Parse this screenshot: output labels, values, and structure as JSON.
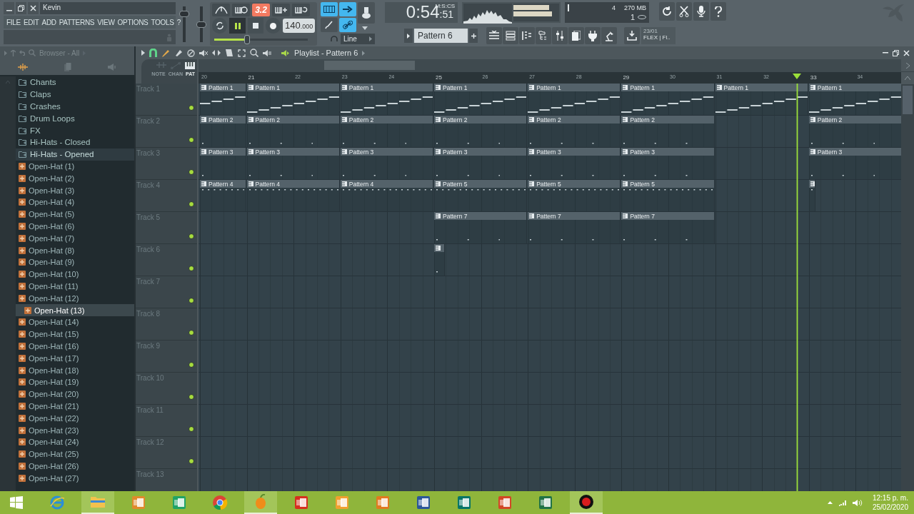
{
  "window": {
    "title": "Kevin"
  },
  "menu": [
    "FILE",
    "EDIT",
    "ADD",
    "PATTERNS",
    "VIEW",
    "OPTIONS",
    "TOOLS",
    "?"
  ],
  "mixer_faders": [
    {
      "level": 0.85
    },
    {
      "level": 0.5
    }
  ],
  "transport": {
    "counter_button": "3.2",
    "playing": true,
    "tempo_main": "140",
    "tempo_fraction": ".000"
  },
  "song_position": {
    "level": 0.35
  },
  "snap": "Line",
  "time": {
    "main": "0:54",
    "small": ":51",
    "unit": "M:S:CS"
  },
  "pattern_selector": "Pattern 6",
  "cpu": {
    "voices": "4",
    "memory": "270 MB",
    "polyphony": "1"
  },
  "news": {
    "date": "23/01",
    "title": "FLEX | Fl.."
  },
  "browser": {
    "title": "Browser - All",
    "items": [
      {
        "label": "Chants",
        "kind": "folder",
        "selected": false
      },
      {
        "label": "Claps",
        "kind": "folder",
        "selected": false
      },
      {
        "label": "Crashes",
        "kind": "folder",
        "selected": false
      },
      {
        "label": "Drum Loops",
        "kind": "folder",
        "selected": false
      },
      {
        "label": "FX",
        "kind": "folder",
        "selected": false
      },
      {
        "label": "Hi-Hats - Closed",
        "kind": "folder",
        "selected": false
      },
      {
        "label": "Hi-Hats - Opened",
        "kind": "folder",
        "selected": true
      },
      {
        "label": "Open-Hat (1)",
        "kind": "file",
        "selected": false
      },
      {
        "label": "Open-Hat (2)",
        "kind": "file",
        "selected": false
      },
      {
        "label": "Open-Hat (3)",
        "kind": "file",
        "selected": false
      },
      {
        "label": "Open-Hat (4)",
        "kind": "file",
        "selected": false
      },
      {
        "label": "Open-Hat (5)",
        "kind": "file",
        "selected": false
      },
      {
        "label": "Open-Hat (6)",
        "kind": "file",
        "selected": false
      },
      {
        "label": "Open-Hat (7)",
        "kind": "file",
        "selected": false
      },
      {
        "label": "Open-Hat (8)",
        "kind": "file",
        "selected": false
      },
      {
        "label": "Open-Hat (9)",
        "kind": "file",
        "selected": false
      },
      {
        "label": "Open-Hat (10)",
        "kind": "file",
        "selected": false
      },
      {
        "label": "Open-Hat (11)",
        "kind": "file",
        "selected": false
      },
      {
        "label": "Open-Hat (12)",
        "kind": "file",
        "selected": false
      },
      {
        "label": "Open-Hat (13)",
        "kind": "file",
        "selected": true
      },
      {
        "label": "Open-Hat (14)",
        "kind": "file",
        "selected": false
      },
      {
        "label": "Open-Hat (15)",
        "kind": "file",
        "selected": false
      },
      {
        "label": "Open-Hat (16)",
        "kind": "file",
        "selected": false
      },
      {
        "label": "Open-Hat (17)",
        "kind": "file",
        "selected": false
      },
      {
        "label": "Open-Hat (18)",
        "kind": "file",
        "selected": false
      },
      {
        "label": "Open-Hat (19)",
        "kind": "file",
        "selected": false
      },
      {
        "label": "Open-Hat (20)",
        "kind": "file",
        "selected": false
      },
      {
        "label": "Open-Hat (21)",
        "kind": "file",
        "selected": false
      },
      {
        "label": "Open-Hat (22)",
        "kind": "file",
        "selected": false
      },
      {
        "label": "Open-Hat (23)",
        "kind": "file",
        "selected": false
      },
      {
        "label": "Open-Hat (24)",
        "kind": "file",
        "selected": false
      },
      {
        "label": "Open-Hat (25)",
        "kind": "file",
        "selected": false
      },
      {
        "label": "Open-Hat (26)",
        "kind": "file",
        "selected": false
      },
      {
        "label": "Open-Hat (27)",
        "kind": "file",
        "selected": false
      }
    ]
  },
  "playlist": {
    "title": "Playlist - Pattern 6",
    "header_tabs": [
      {
        "label": "NOTE",
        "selected": false
      },
      {
        "label": "CHAN",
        "selected": false
      },
      {
        "label": "PAT",
        "selected": true
      }
    ],
    "ruler": [
      "20",
      "21",
      "22",
      "23",
      "24",
      "25",
      "26",
      "27",
      "28",
      "29",
      "30",
      "31",
      "32",
      "33",
      "34"
    ],
    "tracks": [
      {
        "name": "Track 1",
        "enabled": true,
        "clips": [
          {
            "label": "Pattern 1",
            "kind": "melody"
          },
          {
            "label": "Pattern 1",
            "kind": "melody"
          },
          {
            "label": "Pattern 1",
            "kind": "melody"
          },
          {
            "label": "Pattern 1",
            "kind": "melody"
          },
          {
            "label": "Pattern 1",
            "kind": "melody"
          },
          {
            "label": "Pattern 1",
            "kind": "melody"
          },
          {
            "label": "Pattern 1",
            "kind": "melody"
          },
          {
            "label": "Pattern 1",
            "kind": "melody"
          }
        ]
      },
      {
        "name": "Track 2",
        "enabled": true,
        "clips": [
          {
            "label": "Pattern 2",
            "kind": "drums"
          },
          {
            "label": "Pattern 2",
            "kind": "drums"
          },
          {
            "label": "Pattern 2",
            "kind": "drums"
          },
          {
            "label": "Pattern 2",
            "kind": "drums"
          },
          {
            "label": "Pattern 2",
            "kind": "drums"
          },
          {
            "label": "Pattern 2",
            "kind": "drums"
          },
          {
            "label": "Pattern 2",
            "kind": "drums"
          }
        ]
      },
      {
        "name": "Track 3",
        "enabled": true,
        "clips": [
          {
            "label": "Pattern 3",
            "kind": "drums"
          },
          {
            "label": "Pattern 3",
            "kind": "drums"
          },
          {
            "label": "Pattern 3",
            "kind": "drums"
          },
          {
            "label": "Pattern 3",
            "kind": "drums"
          },
          {
            "label": "Pattern 3",
            "kind": "drums"
          },
          {
            "label": "Pattern 3",
            "kind": "drums"
          },
          {
            "label": "Pattern 3",
            "kind": "drums"
          }
        ]
      },
      {
        "name": "Track 4",
        "enabled": true,
        "clips": [
          {
            "label": "Pattern 4",
            "kind": "hats"
          },
          {
            "label": "Pattern 4",
            "kind": "hats"
          },
          {
            "label": "Pattern 4",
            "kind": "hats"
          },
          {
            "label": "Pattern 5",
            "kind": "hats"
          },
          {
            "label": "Pattern 5",
            "kind": "hats"
          },
          {
            "label": "Pattern 5",
            "kind": "hats"
          },
          {
            "kind": "hats"
          }
        ]
      },
      {
        "name": "Track 5",
        "enabled": true,
        "clips": [
          {
            "label": "Pattern 7",
            "kind": "drums"
          },
          {
            "label": "Pattern 7",
            "kind": "drums"
          },
          {
            "label": "Pattern 7",
            "kind": "drums"
          }
        ]
      },
      {
        "name": "Track 6",
        "enabled": true,
        "clips": [
          {
            "kind": "drums"
          }
        ]
      },
      {
        "name": "Track 7",
        "enabled": true
      },
      {
        "name": "Track 8",
        "enabled": true
      },
      {
        "name": "Track 9",
        "enabled": true
      },
      {
        "name": "Track 10",
        "enabled": true
      },
      {
        "name": "Track 11",
        "enabled": true
      },
      {
        "name": "Track 12",
        "enabled": true
      },
      {
        "name": "Track 13"
      }
    ]
  },
  "taskbar": {
    "apps": [
      {
        "kind": "start",
        "active": false
      },
      {
        "kind": "browser",
        "active": false
      },
      {
        "kind": "files",
        "active": true
      },
      {
        "kind": "media",
        "active": false
      },
      {
        "kind": "sheet-green",
        "active": false
      },
      {
        "kind": "chrome",
        "active": false
      },
      {
        "kind": "fruit",
        "active": true
      },
      {
        "kind": "red-app",
        "active": false
      },
      {
        "kind": "orange-folder",
        "active": false
      },
      {
        "kind": "tools",
        "active": false
      },
      {
        "kind": "word",
        "active": false
      },
      {
        "kind": "publisher",
        "active": false
      },
      {
        "kind": "powerpoint",
        "active": false
      },
      {
        "kind": "excel",
        "active": false
      },
      {
        "kind": "recorder",
        "active": true
      }
    ],
    "time": "12:15 p. m.",
    "date": "25/02/2020"
  }
}
